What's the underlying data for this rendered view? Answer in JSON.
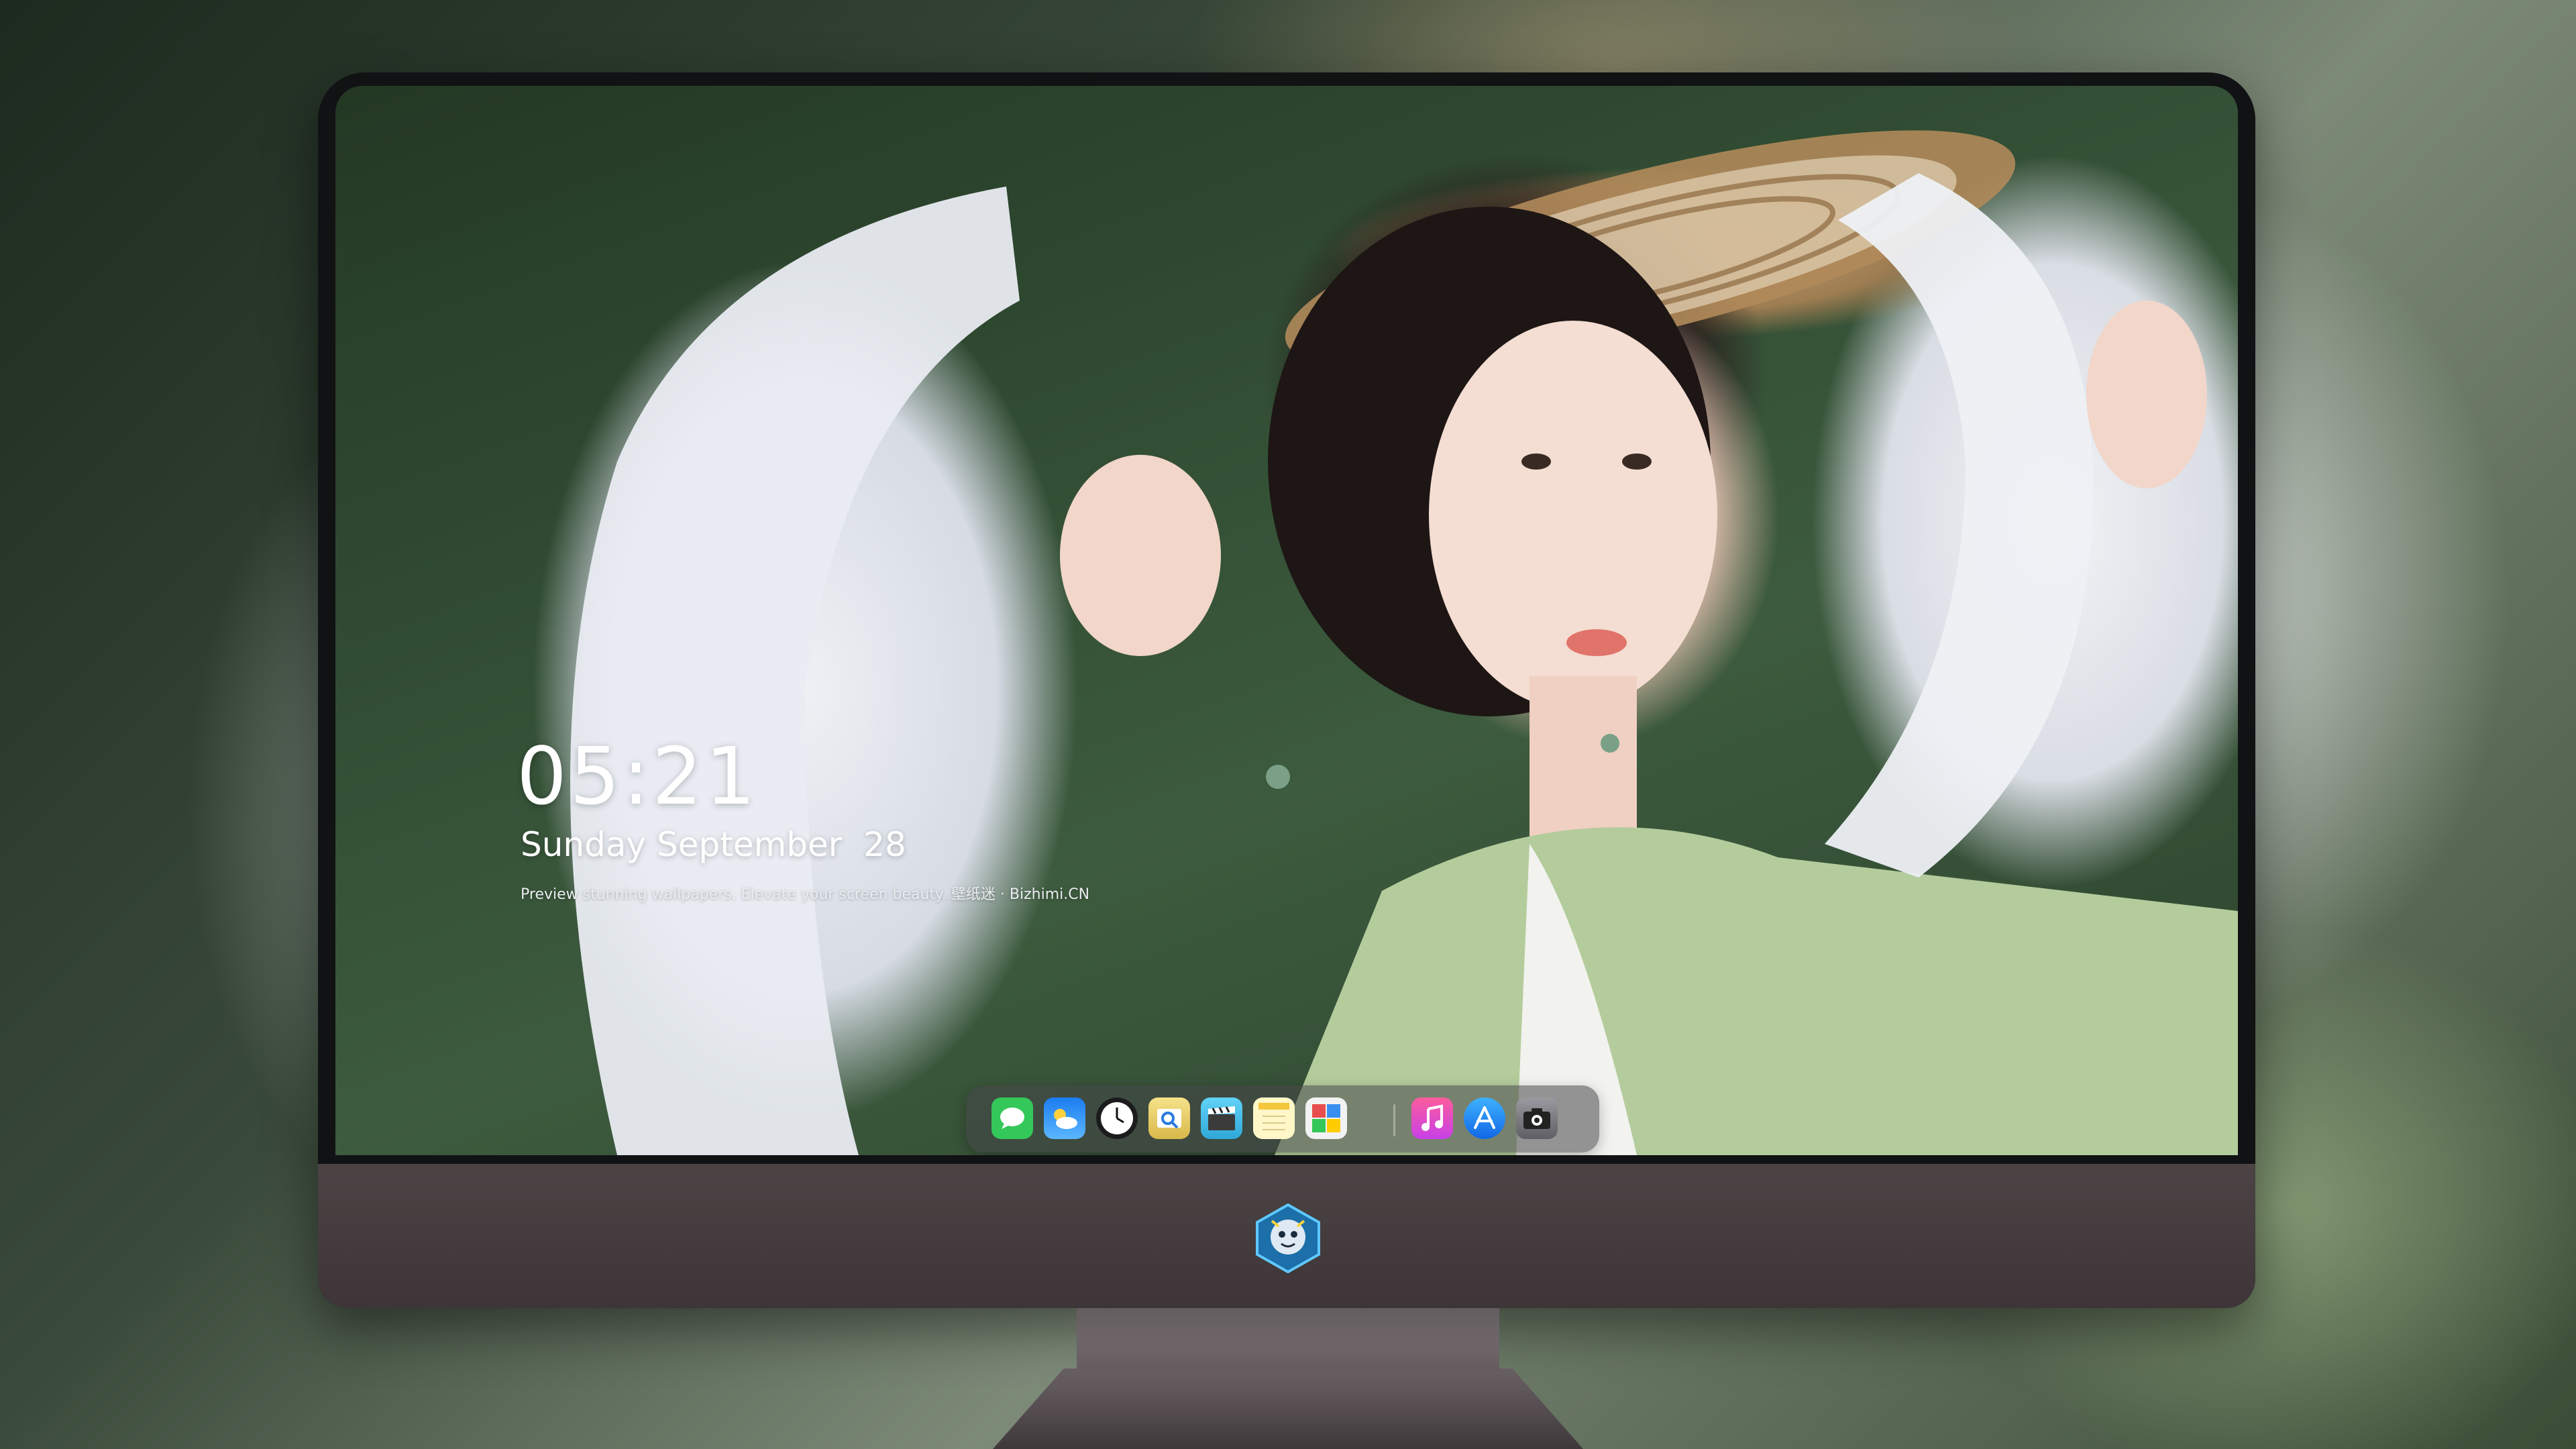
{
  "lock_screen": {
    "time": "05:21",
    "date": "Sunday September  28",
    "tagline": "Preview stunning wallpapers. Elevate your screen beauty. 壁纸迷 · Bizhimi.CN"
  },
  "dock": {
    "apps": [
      {
        "name": "messages",
        "icon": "messages-icon",
        "color": "#34c759"
      },
      {
        "name": "weather",
        "icon": "weather-icon",
        "color": "#3a8ef0"
      },
      {
        "name": "clock",
        "icon": "clock-icon",
        "color": "#1c1c1e"
      },
      {
        "name": "preview",
        "icon": "preview-icon",
        "color": "#f2d46b"
      },
      {
        "name": "video-editor",
        "icon": "clapperboard-icon",
        "color": "#5ac8fa"
      },
      {
        "name": "notes",
        "icon": "notes-icon",
        "color": "#fff4b8"
      },
      {
        "name": "photo-booth",
        "icon": "photo-grid-icon",
        "color": "#e84d4d"
      },
      {
        "name": "music",
        "icon": "music-note-icon",
        "color": "#fc3c8e"
      },
      {
        "name": "app-store",
        "icon": "app-store-icon",
        "color": "#1e8ff5"
      },
      {
        "name": "camera",
        "icon": "camera-icon",
        "color": "#8e8e93"
      }
    ]
  },
  "colors": {
    "chin": "#463e40",
    "bezel": "#111214"
  }
}
